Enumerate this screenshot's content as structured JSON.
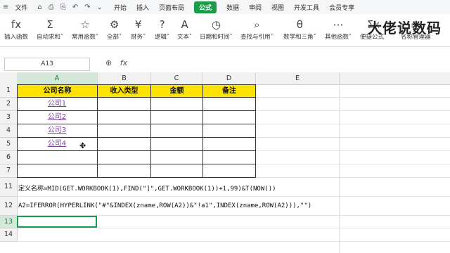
{
  "menubar": {
    "quick_icons": [
      "≡",
      "⌂",
      "⎙",
      "⎘",
      "↶",
      "↷",
      "⌄"
    ],
    "file": "文件",
    "tabs": [
      "开始",
      "插入",
      "页面布局",
      "公式",
      "数据",
      "审阅",
      "视图",
      "开发工具",
      "会员专享"
    ],
    "active_tab": "公式"
  },
  "ribbon": {
    "buttons": [
      {
        "label": "插入函数",
        "icon": "fx"
      },
      {
        "label": "自动求和˅",
        "icon": "Σ"
      },
      {
        "label": "常用函数˅",
        "icon": "☆"
      },
      {
        "label": "全部˅",
        "icon": "⚙"
      },
      {
        "label": "财务˅",
        "icon": "¥"
      },
      {
        "label": "逻辑˅",
        "icon": "?"
      },
      {
        "label": "文本˅",
        "icon": "A"
      },
      {
        "label": "日期和时间˅",
        "icon": "◷"
      },
      {
        "label": "查找与引用˅",
        "icon": "⌕"
      },
      {
        "label": "数学和三角˅",
        "icon": "θ"
      },
      {
        "label": "其他函数˅",
        "icon": "⋯"
      },
      {
        "label": "便捷公式˅",
        "icon": "Σx"
      },
      {
        "label": "名称管理器",
        "icon": "▭"
      }
    ],
    "watermark": "大佬说数码"
  },
  "formula_bar": {
    "name_box": "A13",
    "zoom_icon": "⊕",
    "fx_icon": "fx"
  },
  "columns": [
    "A",
    "B",
    "C",
    "D",
    "E"
  ],
  "selected_column": "A",
  "rows": [
    "1",
    "2",
    "3",
    "4",
    "5",
    "6",
    "7",
    "11",
    "12",
    "13",
    "14"
  ],
  "selected_row": "13",
  "table": {
    "headers": [
      "公司名称",
      "收入类型",
      "金额",
      "备注"
    ],
    "links": [
      "公司1",
      "公司2",
      "公司3",
      "公司4"
    ]
  },
  "notes": {
    "row11": "定义名称=MID(GET.WORKBOOK(1),FIND(\"]\",GET.WORKBOOK(1))+1,99)&T(NOW())",
    "row12": "A2=IFERROR(HYPERLINK(\"#\"&INDEX(zname,ROW(A2))&\"!a1\",INDEX(zname,ROW(A2))),\"\")"
  },
  "colors": {
    "accent": "#1a9d4b",
    "header_fill": "#ffe300",
    "link": "#7b3fa0"
  }
}
